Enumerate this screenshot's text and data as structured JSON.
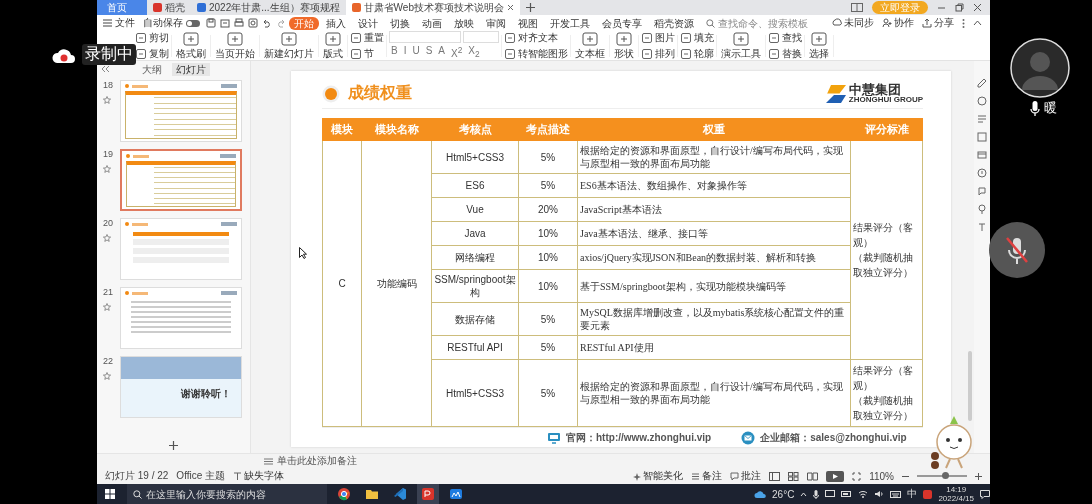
{
  "recording": {
    "label": "录制中"
  },
  "window_tabs": [
    {
      "label": "首页",
      "kind": "home",
      "selected": false
    },
    {
      "label": "稻壳",
      "kind": "doc",
      "color": "#d9342b",
      "selected": false
    },
    {
      "label": "2022年甘肃...生组）赛项规程",
      "kind": "doc",
      "color": "#2f6fd6",
      "selected": false
    },
    {
      "label": "甘肃省Web技术赛项技术说明会",
      "kind": "doc",
      "color": "#e8652a",
      "selected": true
    }
  ],
  "login_button": "立即登录",
  "menu": {
    "file": "文件",
    "autosave": {
      "label": "自动保存",
      "on": false
    },
    "items": [
      {
        "label": "开始",
        "selected": true
      },
      {
        "label": "插入",
        "selected": false
      },
      {
        "label": "设计",
        "selected": false
      },
      {
        "label": "切换",
        "selected": false
      },
      {
        "label": "动画",
        "selected": false
      },
      {
        "label": "放映",
        "selected": false
      },
      {
        "label": "审阅",
        "selected": false
      },
      {
        "label": "视图",
        "selected": false
      },
      {
        "label": "开发工具",
        "selected": false
      },
      {
        "label": "会员专享",
        "selected": false
      },
      {
        "label": "稻壳资源",
        "selected": false
      }
    ],
    "search": {
      "placeholder": "查找命令、搜索模板"
    },
    "actions": [
      {
        "kind": "sync",
        "label": "未同步"
      },
      {
        "kind": "collab",
        "label": "协作"
      },
      {
        "kind": "share",
        "label": "分享"
      }
    ]
  },
  "toolbar": [
    {
      "kind": "stack",
      "items": [
        {
          "label": "剪切"
        },
        {
          "label": "复制"
        }
      ]
    },
    {
      "kind": "large",
      "label": "格式刷"
    },
    {
      "kind": "large",
      "label": "当页开始"
    },
    {
      "kind": "large",
      "label": "新建幻灯片"
    },
    {
      "kind": "large",
      "label": "版式"
    },
    {
      "kind": "stack",
      "items": [
        {
          "label": "重置"
        },
        {
          "label": "节"
        }
      ]
    },
    {
      "kind": "font",
      "buttons": [
        "B",
        "I",
        "U",
        "S",
        "A",
        "X$^{2}$",
        "X$_{2}$"
      ]
    },
    {
      "kind": "stack",
      "items": [
        {
          "label": "对齐文本"
        },
        {
          "label": "转智能图形"
        }
      ]
    },
    {
      "kind": "large",
      "label": "文本框"
    },
    {
      "kind": "large",
      "label": "形状"
    },
    {
      "kind": "stack",
      "items": [
        {
          "label": "图片"
        },
        {
          "label": "排列"
        }
      ]
    },
    {
      "kind": "stack",
      "items": [
        {
          "label": "填充"
        },
        {
          "label": "轮廓"
        }
      ]
    },
    {
      "kind": "large",
      "label": "演示工具"
    },
    {
      "kind": "stack",
      "items": [
        {
          "label": "查找"
        },
        {
          "label": "替换"
        }
      ]
    },
    {
      "kind": "large",
      "label": "选择"
    }
  ],
  "thumbnails": {
    "tabs": [
      {
        "label": "大纲",
        "selected": false
      },
      {
        "label": "幻灯片",
        "selected": true
      }
    ],
    "slides": [
      {
        "number": "18",
        "kind": "table",
        "selected": false
      },
      {
        "number": "19",
        "kind": "table",
        "selected": true
      },
      {
        "number": "20",
        "kind": "list",
        "selected": false
      },
      {
        "number": "21",
        "kind": "text",
        "selected": false
      },
      {
        "number": "22",
        "kind": "closing",
        "title": "谢谢聆听！",
        "selected": false
      }
    ]
  },
  "slide": {
    "title": "成绩权重",
    "logo": {
      "name": "中慧集团",
      "subtitle": "ZHONGHUI GROUP"
    },
    "table": {
      "columns": [
        "模块",
        "模块名称",
        "考核点",
        "考点描述",
        "权重",
        "评分标准"
      ],
      "module": "C",
      "module_name": "功能编码",
      "groups": [
        {
          "scoring": [
            "结果评分（客观）",
            "（裁判随机抽取独立评分）"
          ],
          "rows": [
            {
              "assessment_point": "Html5+CSS3",
              "point_description": "5%",
              "weight": "根据给定的资源和界面原型，自行设计/编写布局代码，实现与原型相一致的界面布局功能"
            },
            {
              "assessment_point": "ES6",
              "point_description": "5%",
              "weight": "ES6基本语法、数组操作、对象操作等"
            },
            {
              "assessment_point": "Vue",
              "point_description": "20%",
              "weight": "JavaScript基本语法"
            },
            {
              "assessment_point": "Java",
              "point_description": "10%",
              "weight": "Java基本语法、继承、接口等"
            },
            {
              "assessment_point": "网络编程",
              "point_description": "10%",
              "weight": "axios/jQuery实现JSON和Bean的数据封装、解析和转换"
            },
            {
              "assessment_point": "SSM/springboot架构",
              "point_description": "10%",
              "weight": "基于SSM/springboot架构，实现功能模块编码等"
            },
            {
              "assessment_point": "数据存储",
              "point_description": "5%",
              "weight": "MySQL数据库增删改查，以及mybatis系统核心配置文件的重要元素"
            },
            {
              "assessment_point": "RESTful API",
              "point_description": "5%",
              "weight": "RESTful API使用"
            }
          ]
        },
        {
          "scoring": [
            "结果评分（客观）",
            "（裁判随机抽取独立评分）"
          ],
          "rows": [
            {
              "assessment_point": "Html5+CSS3",
              "point_description": "5%",
              "weight": "根据给定的资源和界面原型，自行设计/编写布局代码，实现与原型相一致的界面布局功能"
            }
          ]
        }
      ]
    },
    "footer": [
      {
        "kind": "web",
        "text": "官网：http://www.zhonghui.vip"
      },
      {
        "kind": "mail",
        "text": "企业邮箱：sales@zhonghui.vip"
      }
    ]
  },
  "notes_placeholder": "单击此处添加备注",
  "status": {
    "slide_count": "幻灯片 19 / 22",
    "theme": "Office 主题",
    "missing_fonts": "缺失字体",
    "beautify": "智能美化",
    "notes": "备注",
    "comments": "批注",
    "zoom": "110%",
    "zoom_slider": {
      "level": 0.55
    }
  },
  "taskbar": {
    "search": {
      "placeholder": "在这里输入你要搜索的内容"
    },
    "apps": [
      {
        "kind": "browser"
      },
      {
        "kind": "folder"
      },
      {
        "kind": "code"
      },
      {
        "kind": "office"
      },
      {
        "kind": "meeting"
      }
    ],
    "weather": "26°C",
    "ime": "中",
    "time": "14:19",
    "date": "2022/4/15"
  },
  "camera": {
    "name": "暖"
  },
  "remote_mic": {
    "muted": true
  }
}
